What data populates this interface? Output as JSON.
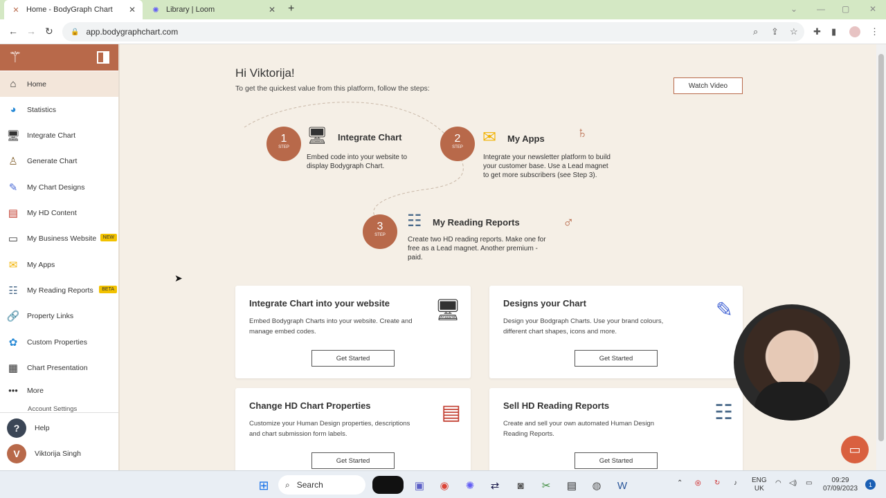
{
  "browser": {
    "tabs": [
      {
        "title": "Home - BodyGraph Chart",
        "icon": "bodygraph-icon"
      },
      {
        "title": "Library | Loom",
        "icon": "loom-icon"
      }
    ],
    "url": "app.bodygraphchart.com"
  },
  "sidebar": {
    "items": [
      {
        "label": "Home",
        "icon": "home-icon"
      },
      {
        "label": "Statistics",
        "icon": "pie-chart-icon"
      },
      {
        "label": "Integrate Chart",
        "icon": "monitor-icon"
      },
      {
        "label": "Generate Chart",
        "icon": "bodygraph-icon"
      },
      {
        "label": "My Chart Designs",
        "icon": "design-icon"
      },
      {
        "label": "My HD Content",
        "icon": "content-icon"
      },
      {
        "label": "My Business Website",
        "icon": "website-icon",
        "badge": "NEW"
      },
      {
        "label": "My Apps",
        "icon": "mail-icon"
      },
      {
        "label": "My Reading Reports",
        "icon": "report-icon",
        "badge": "BETA"
      },
      {
        "label": "Property Links",
        "icon": "link-icon"
      },
      {
        "label": "Custom Properties",
        "icon": "properties-icon"
      },
      {
        "label": "Chart Presentation",
        "icon": "presentation-icon"
      },
      {
        "label": "More",
        "icon": "more-icon"
      }
    ],
    "account_settings": "Account Settings",
    "help": "Help",
    "user": "Viktorija Singh",
    "user_initial": "V"
  },
  "main": {
    "greeting": "Hi Viktorija!",
    "subtitle": "To get the quickest value from this platform, follow the steps:",
    "watch_video": "Watch Video",
    "steps": [
      {
        "number": "1",
        "step_label": "STEP",
        "title": "Integrate Chart",
        "desc": "Embed code into your website to display Bodygraph Chart."
      },
      {
        "number": "2",
        "step_label": "STEP",
        "title": "My Apps",
        "desc": "Integrate your newsletter platform to build your customer base. Use a Lead magnet to get more subscribers (see Step 3)."
      },
      {
        "number": "3",
        "step_label": "STEP",
        "title": "My Reading Reports",
        "desc": "Create two HD reading reports. Make one for free as a Lead magnet. Another premium - paid."
      }
    ],
    "cards": [
      {
        "title": "Integrate Chart into your website",
        "desc": "Embed Bodygraph Charts into your website. Create and manage embed codes.",
        "button": "Get Started"
      },
      {
        "title": "Designs your Chart",
        "desc": "Design your Bodgraph Charts. Use your brand colours, different chart shapes, icons and more.",
        "button": "Get Started"
      },
      {
        "title": "Change HD Chart Properties",
        "desc": "Customize your Human Design properties, descriptions and chart submission form labels.",
        "button": "Get Started"
      },
      {
        "title": "Sell HD Reading Reports",
        "desc": "Create and sell your own automated Human Design Reading Reports.",
        "button": "Get Started"
      }
    ]
  },
  "taskbar": {
    "search": "Search",
    "lang": "ENG",
    "region": "UK",
    "time": "09:29",
    "date": "07/09/2023",
    "notif": "1"
  },
  "colors": {
    "accent": "#b8694a",
    "tab_bar": "#d4e8c4",
    "badge": "#f2c200"
  }
}
